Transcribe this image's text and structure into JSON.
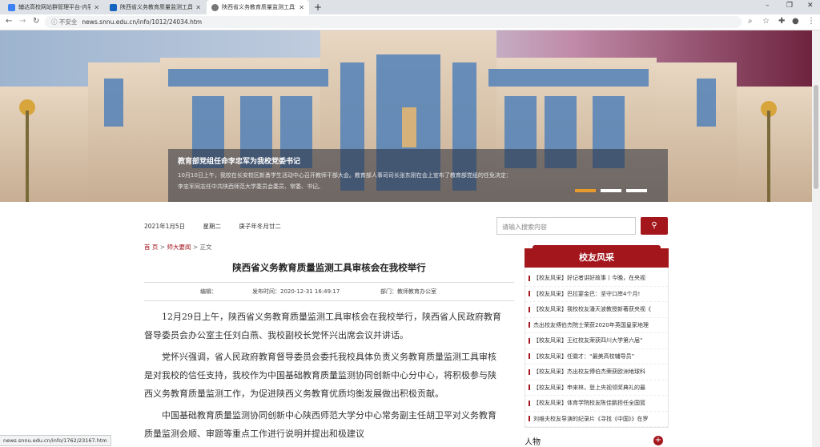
{
  "browser": {
    "tabs": [
      {
        "title": "辅达高校网站群管理平台-内容管理",
        "active": false,
        "fav": "#3b82f6"
      },
      {
        "title": "陕西省义务教育质量监测工具审核",
        "active": false,
        "fav": "#1565c0"
      },
      {
        "title": "陕西省义务教育质量监测工具审核",
        "active": true,
        "fav": "#777"
      }
    ],
    "new_tab": "+",
    "window_controls": [
      "–",
      "❐",
      "✕"
    ],
    "address": {
      "warning": "ⓘ 不安全",
      "url": "news.snnu.edu.cn/info/1012/24034.htm"
    }
  },
  "hero": {
    "caption_title": "教育部党组任命李忠军为我校党委书记",
    "caption_text": "10月10日上午，我校在长安校区新勇学生活动中心召开教师干部大会。教育部人事司司长张东刚在会上宣布了教育部党组的任免决定：李忠军同志任中共陕西师范大学委员会委员、常委、书记。",
    "library_sign": "图书馆"
  },
  "header": {
    "date": "2021年1月5日",
    "weekday": "星期二",
    "lunar": "庚子年冬月廿二",
    "search_placeholder": "请输入搜索内容"
  },
  "breadcrumb": {
    "home": "首 页",
    "sep": ">",
    "section": "师大要闻",
    "current": "正文"
  },
  "article": {
    "title": "陕西省义务教育质量监测工具审核会在我校举行",
    "editor": "编辑：",
    "published": "发布时间：2020-12-31 16:49:17",
    "department": "部门：教师教育办公室",
    "paragraphs": [
      "12月29日上午，陕西省义务教育质量监测工具审核会在我校举行，陕西省人民政府教育督导委员会办公室主任刘白燕、我校副校长党怀兴出席会议并讲话。",
      "党怀兴强调，省人民政府教育督导委员会委托我校具体负责义务教育质量监测工具审核是对我校的信任支持，我校作为中国基础教育质量监测协同创新中心分中心，将积极参与陕西义务教育质量监测工作，为促进陕西义务教育优质均衡发展做出积极贡献。",
      "中国基础教育质量监测协同创新中心陕西师范大学分中心常务副主任胡卫平对义务教育质量监测会顺、审题等重点工作进行说明并提出和极建议"
    ]
  },
  "sidebar": {
    "heading": "校友风采",
    "items": [
      "【校友风采】好记者讲好故事丨今晚，在央视",
      "【校友风采】巴拉宴金巴：坚守口岸4个月!",
      "【校友风采】我校校友潘天波教授新著获央视《",
      "杰出校友傅伯杰院士荣获2020年英国皇家地理",
      "【校友风采】王红校友荣获四川大学第六届“",
      "【校友风采】任徽才：“最美高校辅导员”",
      "【校友风采】杰出校友傅伯杰荣获欧洲地球科",
      "【校友风采】申来林，登上央视领奖典礼的最",
      "【校友风采】体育学院校友陈佳鹏担任全国篮",
      "刘维夫校友导演的纪录片《寻找《中国》》在罗"
    ],
    "next_heading": "人物",
    "plus": "+"
  },
  "status_url": "news.snnu.edu.cn/info/1762/23167.htm"
}
